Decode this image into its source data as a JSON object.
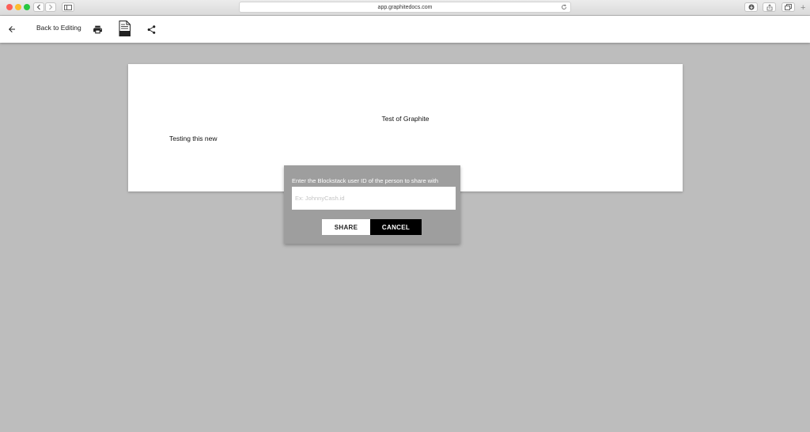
{
  "browser": {
    "url": "app.graphitedocs.com",
    "new_tab_symbol": "+"
  },
  "toolbar": {
    "back_label": "Back to Editing",
    "icons": [
      "back-arrow-icon",
      "print-icon",
      "docx-icon",
      "share-icon"
    ]
  },
  "document": {
    "title": "Test of Graphite",
    "body": "Testing this new"
  },
  "share_dialog": {
    "prompt": "Enter the Blockstack user ID of the person to share with",
    "input_placeholder": "Ex: JohnnyCash.id",
    "input_value": "",
    "share_label": "SHARE",
    "cancel_label": "CANCEL"
  },
  "colors": {
    "background": "#bdbdbd",
    "dialog_bg": "#9e9e9e",
    "cancel_bg": "#000000",
    "share_bg": "#ffffff"
  }
}
